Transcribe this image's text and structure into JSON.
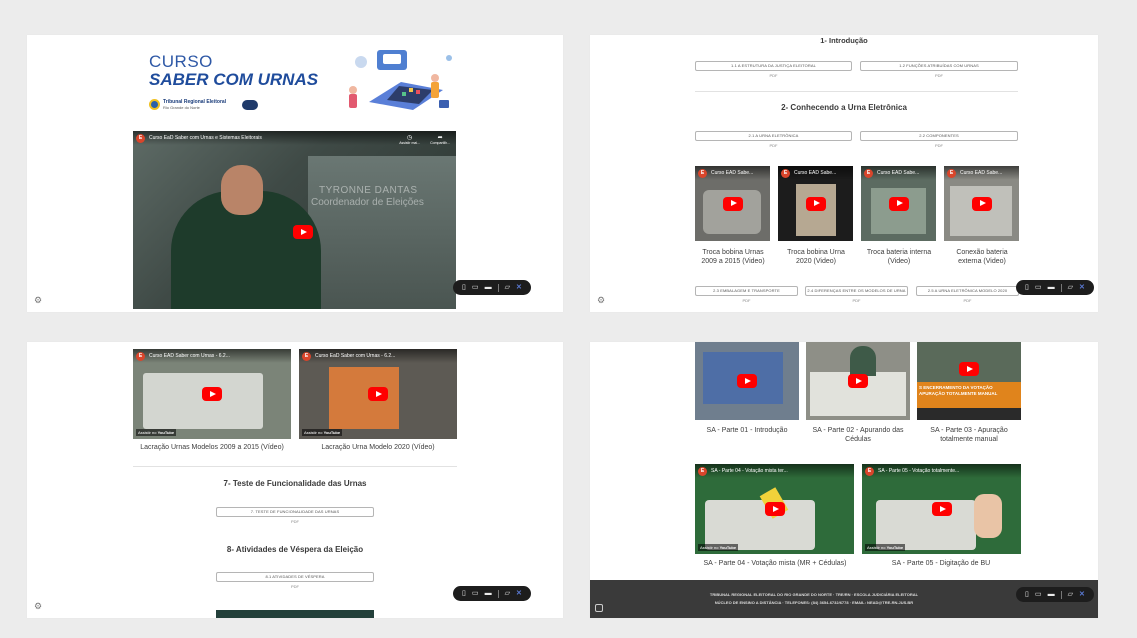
{
  "panel1": {
    "course_line1": "CURSO",
    "course_line2": "SABER COM URNAS",
    "org_line1": "Tribunal Regional Eleitoral",
    "org_line2": "Rio Grande do Norte",
    "video_title": "Curso EaD Saber com Urnas e Sistemas Eleitorais",
    "video_person": "TYRONNE DANTAS",
    "video_role": "Coordenador de Eleições",
    "video_watch_later": "Assistir mai...",
    "video_share": "Compartilh..."
  },
  "panel2": {
    "s1_title": "1- Introdução",
    "s1_btn1": "1.1 A ESTRUTURA DA JUSTIÇA ELEITORAL",
    "s1_btn2": "1.2 FUNÇÕES ATRIBUÍDAS COM URNAS",
    "s2_title": "2- Conhecendo a Urna Eletrônica",
    "s2_btn1": "2.1 A URNA ELETRÔNICA",
    "s2_btn2": "2.2 COMPONENTES",
    "pdf": "PDF",
    "videos": [
      {
        "title": "Curso EAD Sabe...",
        "caption_l1": "Troca bobina Urnas",
        "caption_l2": "2009 a 2015 (Video)"
      },
      {
        "title": "Curso EAD Sabe...",
        "caption_l1": "Troca bobina Urna",
        "caption_l2": "2020 (Video)"
      },
      {
        "title": "Curso EAD Sabe...",
        "caption_l1": "Troca bateria interna",
        "caption_l2": "(Video)"
      },
      {
        "title": "Curso EAD Sabe...",
        "caption_l1": "Conexão bateria",
        "caption_l2": "externa (Video)"
      }
    ],
    "btn_b1": "2.3 EMBALAGEM E TRANSPORTE",
    "btn_b2": "2.4 DIFERENÇAS ENTRE OS MODELOS DE URNA",
    "btn_b3": "2.5 A URNA ELETRÔNICA MODELO 2020"
  },
  "panel3": {
    "videos": [
      {
        "title": "Curso EAD Saber com Urnas - 6.2...",
        "caption": "Lacração Urnas Modelos 2009 a 2015 (Vídeo)"
      },
      {
        "title": "Curso EaD Saber com Urnas - 6.2...",
        "caption": "Lacração Urna Modelo 2020 (Vídeo)"
      }
    ],
    "watch_on": "Assistir no",
    "youtube": "YouTube",
    "s7_title": "7- Teste de Funcionalidade das Urnas",
    "s7_btn": "7. TESTE DE FUNCIONALIDADE DAS URNAS",
    "s8_title": "8- Atividades de Véspera da Eleição",
    "s8_btn": "8.1 ATIVIDADES DE VÉSPERA",
    "pdf": "PDF"
  },
  "panel4": {
    "top_videos": [
      {
        "caption_l1": "SA - Parte 01 - Introdução",
        "caption_l2": ""
      },
      {
        "caption_l1": "SA - Parte 02 - Apurando das",
        "caption_l2": "Cédulas"
      },
      {
        "caption_l1": "SA - Parte 03 - Apuração",
        "caption_l2": "totalmente manual"
      }
    ],
    "overlay_l1": "S ENCERRAMENTO DA VOTAÇÃO",
    "overlay_l2": "APURAÇÃO TOTALMENTE MANUAL",
    "bottom_videos": [
      {
        "title": "SA - Parte 04 - Votação mista ter...",
        "caption": "SA - Parte 04 - Votação mista (MR + Cédulas)"
      },
      {
        "title": "SA - Parte 05 - Votação totalmente...",
        "caption": "SA - Parte 05 - Digitação de BU"
      }
    ],
    "watch_on": "Assistir no",
    "youtube": "YouTube",
    "footer_l1": "TRIBUNAL REGIONAL ELEITORAL DO RIO GRANDE DO NORTE · TRE/RN · ESCOLA JUDICIÁRIA ELEITORAL",
    "footer_l2": "NÚCLEO DE ENSINO A DISTÂNCIA · TELEFONES: (84) 3654-6732/6778 · EMAIL: NEAD@TRE-RN.JUS.BR"
  }
}
